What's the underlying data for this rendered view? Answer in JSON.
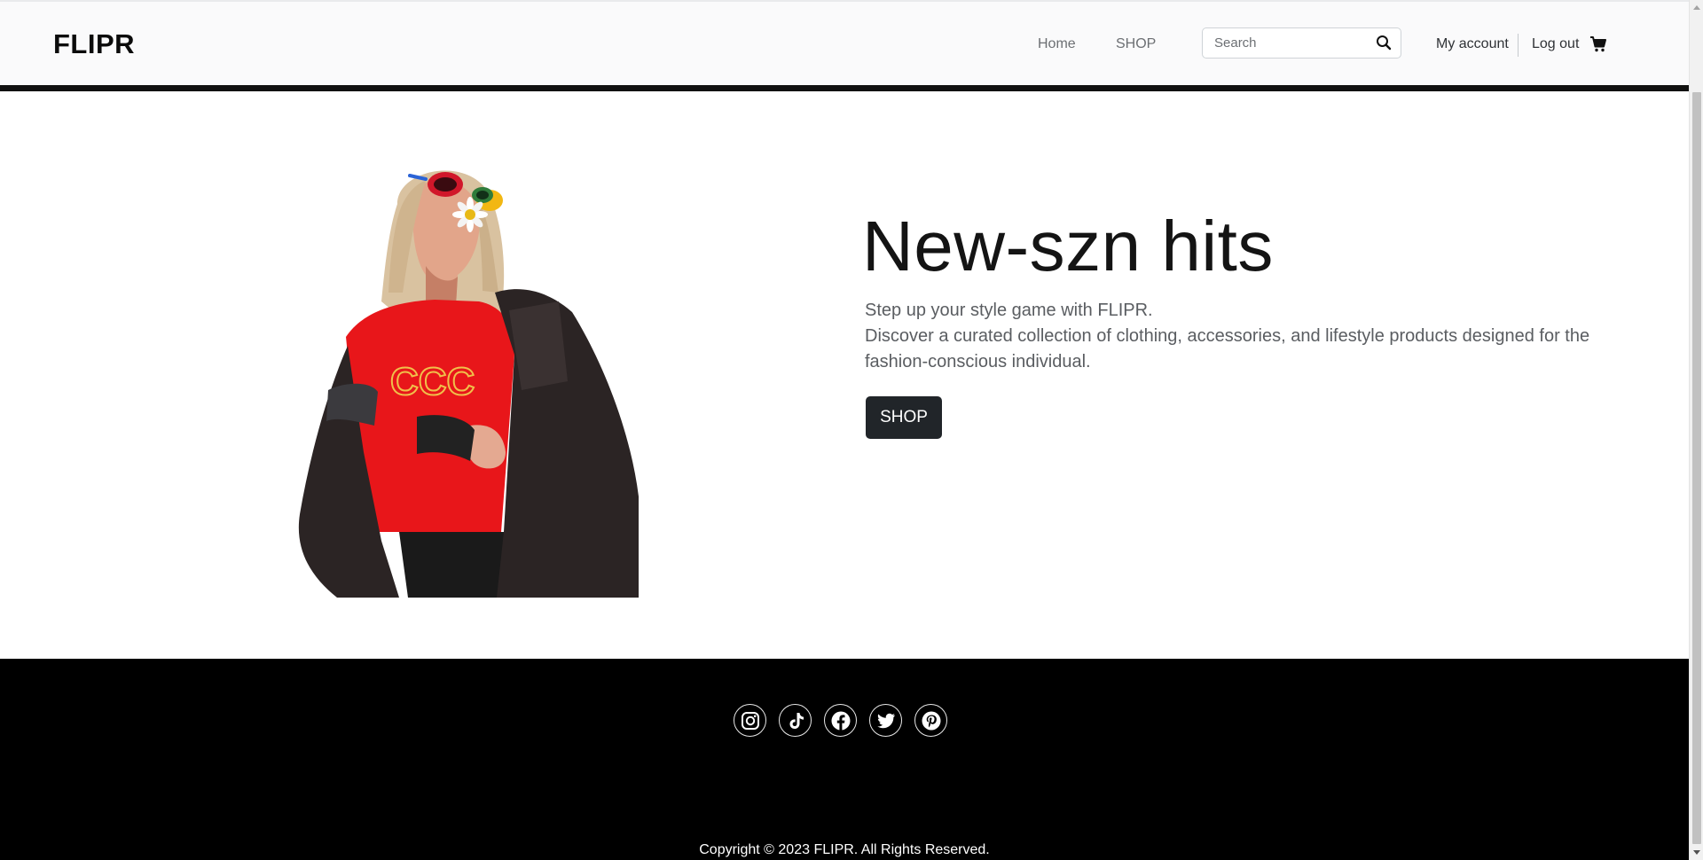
{
  "header": {
    "brand": "FLIPR",
    "nav": {
      "home_label": "Home",
      "shop_label": "SHOP"
    },
    "search": {
      "placeholder": "Search",
      "value": ""
    },
    "account_label": "My account",
    "logout_label": "Log out"
  },
  "hero": {
    "title": "New-szn hits",
    "line1": "Step up your style game with FLIPR.",
    "line2": "Discover a curated collection of clothing, accessories, and lifestyle products designed for the fashion-conscious individual.",
    "button_label": "SHOP"
  },
  "footer": {
    "socials": [
      "instagram-icon",
      "tiktok-icon",
      "facebook-icon",
      "twitter-icon",
      "pinterest-icon"
    ],
    "copyright": "Copyright © 2023 FLIPR. All Rights Reserved."
  },
  "colors": {
    "header_bg": "#fafafb",
    "header_rule": "#111111",
    "button_bg": "#212529",
    "footer_bg": "#000000",
    "tshirt_red": "#e8161a"
  }
}
